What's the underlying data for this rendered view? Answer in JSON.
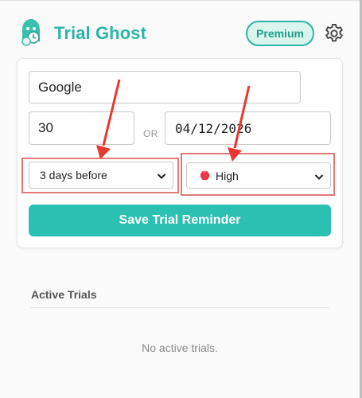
{
  "header": {
    "app_title": "Trial Ghost",
    "premium_label": "Premium",
    "logo_icon": "ghost-logo-icon",
    "settings_icon": "gear-icon"
  },
  "form": {
    "service_name_value": "Google",
    "trial_days_value": "30",
    "or_label": "OR",
    "end_date_value": "04/12/2026",
    "reminder_select": {
      "selected": "3 days before",
      "icon": "chevron-down-icon"
    },
    "priority_select": {
      "selected": "High",
      "icon": "red-gem-icon",
      "chevron_icon": "chevron-down-icon"
    },
    "save_button_label": "Save Trial Reminder"
  },
  "active_trials": {
    "title": "Active Trials",
    "empty_message": "No active trials."
  },
  "colors": {
    "accent": "#2cc0b2",
    "title": "#2cb5a6",
    "premium_bg": "#d9f5ee",
    "annotation_arrow": "#e8382f",
    "annotation_box": "#e07a7a",
    "priority_high": "#e8384a"
  }
}
